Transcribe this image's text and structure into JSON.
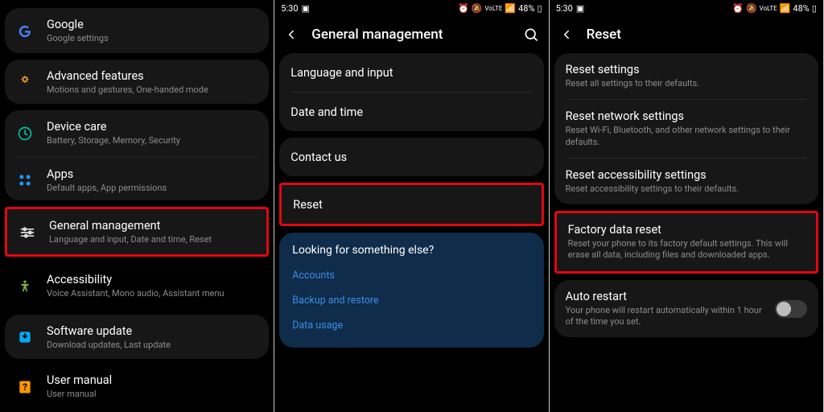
{
  "status": {
    "time": "5:30",
    "battery": "48%"
  },
  "panel1": {
    "items": [
      {
        "title": "Google",
        "sub": "Google settings"
      },
      {
        "title": "Advanced features",
        "sub": "Motions and gestures, One-handed mode"
      },
      {
        "title": "Device care",
        "sub": "Battery, Storage, Memory, Security"
      },
      {
        "title": "Apps",
        "sub": "Default apps, App permissions"
      },
      {
        "title": "General management",
        "sub": "Language and input, Date and time, Reset"
      },
      {
        "title": "Accessibility",
        "sub": "Voice Assistant, Mono audio, Assistant menu"
      },
      {
        "title": "Software update",
        "sub": "Download updates, Last update"
      },
      {
        "title": "User manual",
        "sub": "User manual"
      }
    ]
  },
  "panel2": {
    "header": "General management",
    "rows": {
      "lang": "Language and input",
      "date": "Date and time",
      "contact": "Contact us",
      "reset": "Reset"
    },
    "looking": "Looking for something else?",
    "links": {
      "accounts": "Accounts",
      "backup": "Backup and restore",
      "data": "Data usage"
    }
  },
  "panel3": {
    "header": "Reset",
    "items": [
      {
        "title": "Reset settings",
        "sub": "Reset all settings to their defaults."
      },
      {
        "title": "Reset network settings",
        "sub": "Reset Wi-Fi, Bluetooth, and other network settings to their defaults."
      },
      {
        "title": "Reset accessibility settings",
        "sub": "Reset accessibility settings to their defaults."
      },
      {
        "title": "Factory data reset",
        "sub": "Reset your phone to its factory default settings. This will erase all data, including files and downloaded apps."
      }
    ],
    "auto": {
      "title": "Auto restart",
      "sub": "Your phone will restart automatically within 1 hour of the time you set."
    }
  }
}
